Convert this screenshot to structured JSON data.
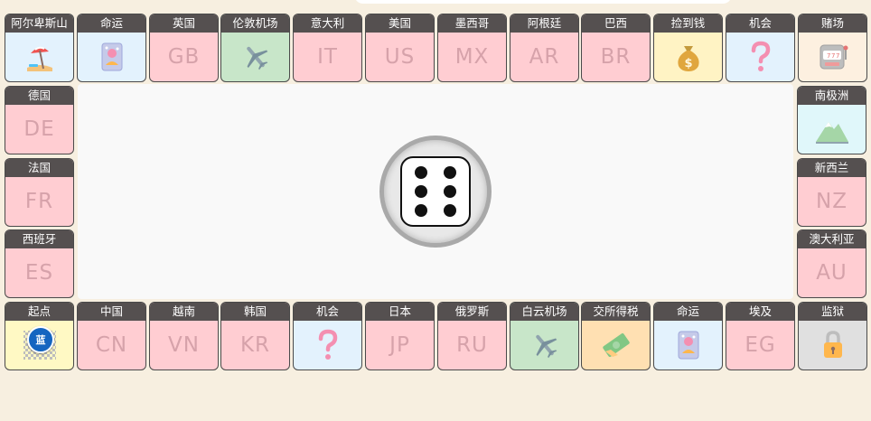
{
  "board": {
    "top": [
      {
        "name": "阿尔卑斯山",
        "type": "scenic",
        "icon": "beach-icon",
        "bg": "blue"
      },
      {
        "name": "命运",
        "type": "fate",
        "icon": "fate-card-icon",
        "bg": "blue"
      },
      {
        "name": "英国",
        "type": "country",
        "code": "GB",
        "bg": "country"
      },
      {
        "name": "伦敦机场",
        "type": "airport",
        "icon": "airplane-icon",
        "bg": "green"
      },
      {
        "name": "意大利",
        "type": "country",
        "code": "IT",
        "bg": "country"
      },
      {
        "name": "美国",
        "type": "country",
        "code": "US",
        "bg": "country"
      },
      {
        "name": "墨西哥",
        "type": "country",
        "code": "MX",
        "bg": "country"
      },
      {
        "name": "阿根廷",
        "type": "country",
        "code": "AR",
        "bg": "country"
      },
      {
        "name": "巴西",
        "type": "country",
        "code": "BR",
        "bg": "country"
      },
      {
        "name": "捡到钱",
        "type": "money",
        "icon": "money-bag-icon",
        "bg": "yellow"
      },
      {
        "name": "机会",
        "type": "chance",
        "icon": "question-icon",
        "bg": "blue"
      },
      {
        "name": "赌场",
        "type": "casino",
        "icon": "slot-machine-icon",
        "bg": "cream"
      }
    ],
    "left": [
      {
        "name": "德国",
        "type": "country",
        "code": "DE",
        "bg": "country"
      },
      {
        "name": "法国",
        "type": "country",
        "code": "FR",
        "bg": "country"
      },
      {
        "name": "西班牙",
        "type": "country",
        "code": "ES",
        "bg": "country"
      }
    ],
    "right": [
      {
        "name": "南极洲",
        "type": "scenic",
        "icon": "mountain-icon",
        "bg": "cyan"
      },
      {
        "name": "新西兰",
        "type": "country",
        "code": "NZ",
        "bg": "country"
      },
      {
        "name": "澳大利亚",
        "type": "country",
        "code": "AU",
        "bg": "country"
      }
    ],
    "bottom": [
      {
        "name": "起点",
        "type": "start",
        "icon": "checkered-flag-icon",
        "bg": "start"
      },
      {
        "name": "中国",
        "type": "country",
        "code": "CN",
        "bg": "country"
      },
      {
        "name": "越南",
        "type": "country",
        "code": "VN",
        "bg": "country"
      },
      {
        "name": "韩国",
        "type": "country",
        "code": "KR",
        "bg": "country"
      },
      {
        "name": "机会",
        "type": "chance",
        "icon": "question-icon",
        "bg": "blue"
      },
      {
        "name": "日本",
        "type": "country",
        "code": "JP",
        "bg": "country"
      },
      {
        "name": "俄罗斯",
        "type": "country",
        "code": "RU",
        "bg": "country"
      },
      {
        "name": "白云机场",
        "type": "airport",
        "icon": "airplane-icon",
        "bg": "green"
      },
      {
        "name": "交所得税",
        "type": "tax",
        "icon": "money-icon",
        "bg": "orange"
      },
      {
        "name": "命运",
        "type": "fate",
        "icon": "fate-card-icon",
        "bg": "blue"
      },
      {
        "name": "埃及",
        "type": "country",
        "code": "EG",
        "bg": "country"
      },
      {
        "name": "监狱",
        "type": "jail",
        "icon": "lock-icon",
        "bg": "gray"
      }
    ]
  },
  "player": {
    "label": "蓝",
    "color": "#1565c0"
  },
  "dice": {
    "value": 6
  },
  "colors": {
    "background": "#f7efe0",
    "country": "#ffcdd2",
    "header": "#555050",
    "code_text": "#d6a2aa"
  }
}
